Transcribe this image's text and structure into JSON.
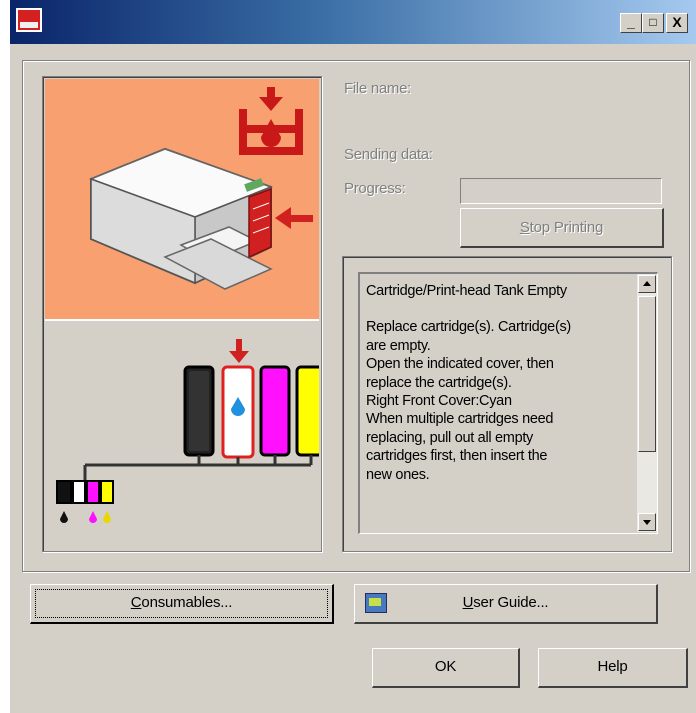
{
  "window": {
    "icon": "printer-status-icon",
    "controls": {
      "minimize": "_",
      "maximize": "□",
      "close": "X"
    }
  },
  "status": {
    "file_name_label": "File name:",
    "sending_data_label": "Sending data:",
    "progress_label": "Progress:",
    "stop_printing": {
      "hotkey": "S",
      "rest": "top Printing"
    }
  },
  "message": {
    "heading": "Cartridge/Print-head Tank Empty",
    "lines": [
      "Replace cartridge(s). Cartridge(s)",
      "are empty.",
      "Open the indicated cover, then",
      "replace the cartridge(s).",
      "Right Front Cover:Cyan",
      "When multiple cartridges need",
      "replacing, pull out all empty",
      "cartridges first, then insert the",
      "new ones."
    ]
  },
  "illustration": {
    "printer": "printer-with-open-cover-icon",
    "tank": "ink-tank-drop-icon",
    "cartridges": [
      {
        "name": "black",
        "color": "#222222",
        "empty": false
      },
      {
        "name": "cyan",
        "color": "#ffffff",
        "empty": true
      },
      {
        "name": "magenta",
        "color": "#ff10ff",
        "empty": false
      },
      {
        "name": "yellow",
        "color": "#ffff00",
        "empty": false
      }
    ],
    "highlight_color": "#e02020"
  },
  "buttons": {
    "consumables": {
      "hotkey": "C",
      "rest": "onsumables..."
    },
    "user_guide": {
      "hotkey": "U",
      "rest": "ser Guide..."
    },
    "ok": "OK",
    "help": "Help"
  }
}
